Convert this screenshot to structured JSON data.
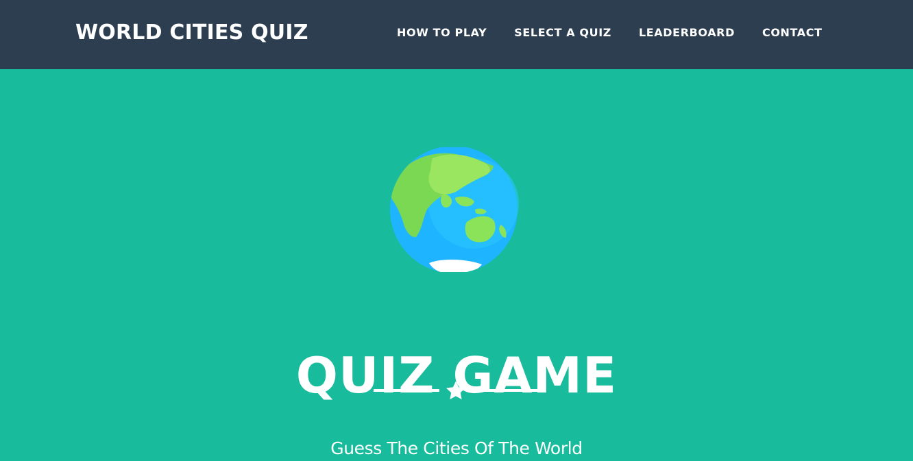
{
  "navbar": {
    "brand": "WORLD CITIES QUIZ",
    "links": [
      {
        "label": "HOW TO PLAY"
      },
      {
        "label": "SELECT A QUIZ"
      },
      {
        "label": "LEADERBOARD"
      },
      {
        "label": "CONTACT"
      }
    ]
  },
  "hero": {
    "image_icon": "globe-icon",
    "title": "QUIZ GAME",
    "divider_icon": "star-icon",
    "subtitle": "Guess The Cities Of The World"
  },
  "colors": {
    "navbar_bg": "#2c3e50",
    "hero_bg": "#18bc9c",
    "text": "#ffffff",
    "ocean": "#21b5f8",
    "land": "#8be35a"
  }
}
